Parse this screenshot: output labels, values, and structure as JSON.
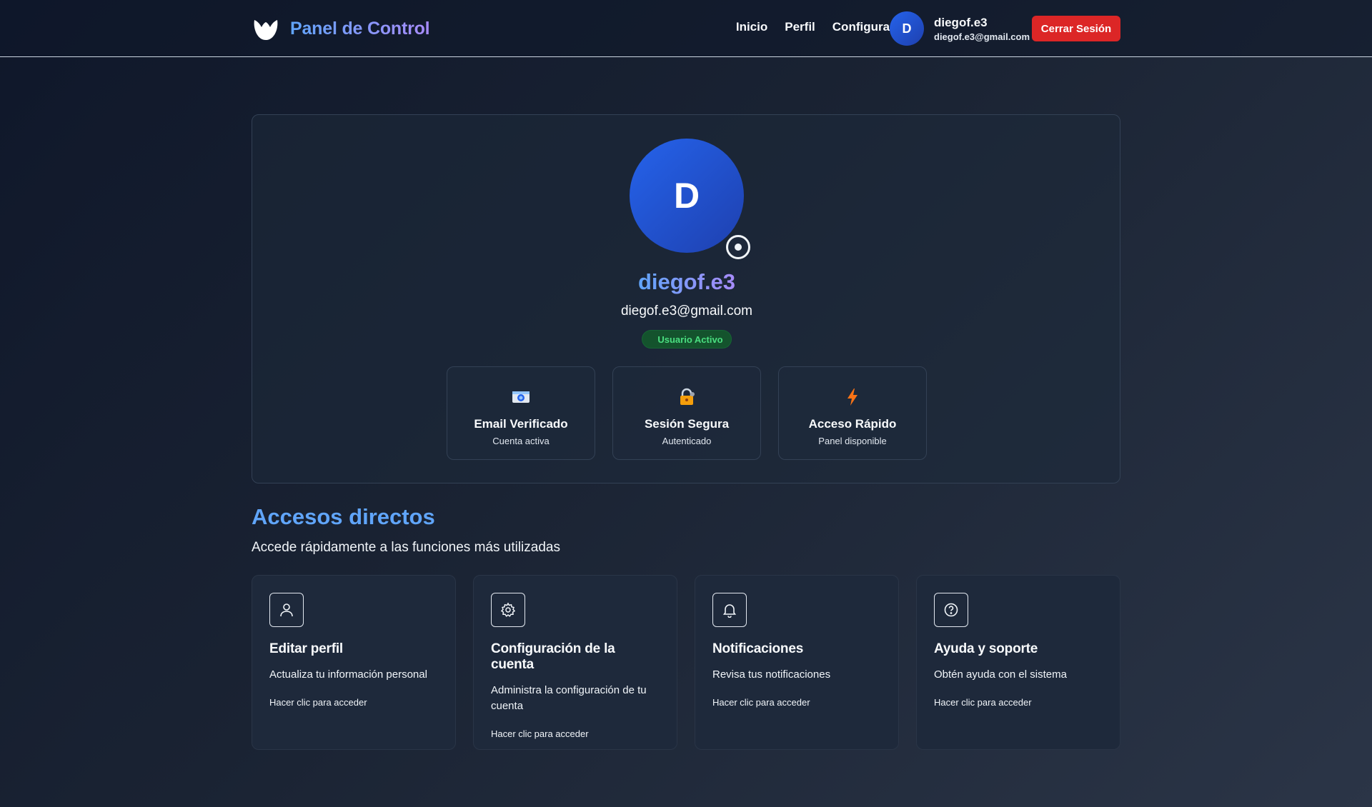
{
  "header": {
    "brand": "Panel de Control",
    "nav": [
      "Inicio",
      "Perfil",
      "Configuración"
    ],
    "user": {
      "initial": "D",
      "name": "diegof.e3",
      "email": "diegof.e3@gmail.com"
    },
    "logout_label": "Cerrar Sesión"
  },
  "profile": {
    "initial": "D",
    "name": "diegof.e3",
    "email": "diegof.e3@gmail.com",
    "status": "Usuario Activo",
    "features": [
      {
        "icon": "id-card-icon",
        "title": "Email Verificado",
        "subtitle": "Cuenta activa"
      },
      {
        "icon": "lock-key-icon",
        "title": "Sesión Segura",
        "subtitle": "Autenticado"
      },
      {
        "icon": "lightning-icon",
        "title": "Acceso Rápido",
        "subtitle": "Panel disponible"
      }
    ]
  },
  "shortcuts": {
    "title": "Accesos directos",
    "subtitle": "Accede rápidamente a las funciones más utilizadas",
    "items": [
      {
        "icon": "user-icon",
        "title": "Editar perfil",
        "description": "Actualiza tu información personal",
        "cta": "Hacer clic para acceder"
      },
      {
        "icon": "gear-icon",
        "title": "Configuración de la cuenta",
        "description": "Administra la configuración de tu cuenta",
        "cta": "Hacer clic para acceder"
      },
      {
        "icon": "bell-icon",
        "title": "Notificaciones",
        "description": "Revisa tus notificaciones",
        "cta": "Hacer clic para acceder"
      },
      {
        "icon": "help-icon",
        "title": "Ayuda y soporte",
        "description": "Obtén ayuda con el sistema",
        "cta": "Hacer clic para acceder"
      }
    ]
  },
  "colors": {
    "accent_blue": "#60a5fa",
    "accent_purple": "#a78bfa",
    "danger": "#dc2626",
    "success": "#4ade80"
  }
}
